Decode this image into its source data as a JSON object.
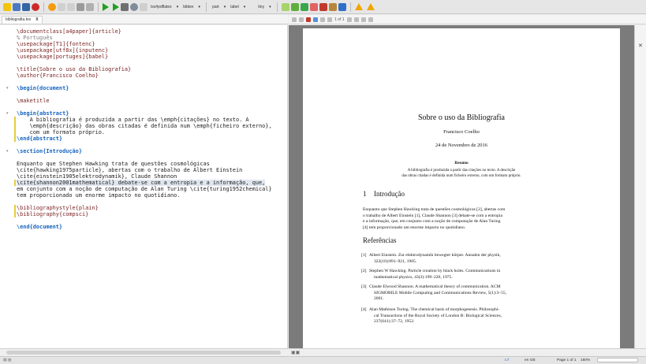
{
  "toolbar": {
    "typeset_format": "txs#pdflatex",
    "bibtool": "bibtex",
    "selects": [
      "part",
      "label",
      "tiny"
    ]
  },
  "editor": {
    "tab_label": "bibliografia.tex",
    "tab_close": "X",
    "lines": [
      {
        "t": "\\documentclass[a4paper]{article}",
        "c": "cmd"
      },
      {
        "t": "% Português",
        "c": "cm"
      },
      {
        "t": "\\usepackage[T1]{fontenc}",
        "c": "cmd"
      },
      {
        "t": "\\usepackage[utf8x]{inputenc}",
        "c": "cmd"
      },
      {
        "t": "\\usepackage[portuges]{babel}",
        "c": "cmd"
      },
      {
        "t": "",
        "c": ""
      },
      {
        "t": "\\title{Sobre o uso da Bibliografia}",
        "c": "cmd"
      },
      {
        "t": "\\author{Francisco Coelho}",
        "c": "cmd"
      },
      {
        "t": "",
        "c": ""
      },
      {
        "t": "\\begin{document}",
        "c": "env"
      },
      {
        "t": "",
        "c": ""
      },
      {
        "t": "\\maketitle",
        "c": "cmd"
      },
      {
        "t": "",
        "c": ""
      },
      {
        "t": "\\begin{abstract}",
        "c": "env"
      },
      {
        "t": "    A bibliografia é produzida a partir das \\emph{citações} no texto. A",
        "c": ""
      },
      {
        "t": "    \\emph{descrição} das obras citadas é definida num \\emph{ficheiro externo},",
        "c": ""
      },
      {
        "t": "    com um formato próprio.",
        "c": ""
      },
      {
        "t": "\\end{abstract}",
        "c": "env"
      },
      {
        "t": "",
        "c": ""
      },
      {
        "t": "\\section{Introdução}",
        "c": "env"
      },
      {
        "t": "",
        "c": ""
      },
      {
        "t": "Enquanto que Stephen Hawking trata de questões cosmológicas",
        "c": ""
      },
      {
        "t": "\\cite{hawking1975particle}, abertas com o trabalho de Albert Einstein",
        "c": ""
      },
      {
        "t": "\\cite{einstein1905elektrodynamik}, Claude Shannon",
        "c": ""
      },
      {
        "t": "\\cite{shannon2001mathematical} debate-se com a entropia e a informação, que,",
        "c": ""
      },
      {
        "t": "em conjunto com a noção de computação de Alan Turing \\cite{turing1952chemical}",
        "c": ""
      },
      {
        "t": "tem proporcionado um enorme impacto no quotidiano.",
        "c": ""
      },
      {
        "t": "",
        "c": ""
      },
      {
        "t": "\\bibliographystyle{plain}",
        "c": "cmd"
      },
      {
        "t": "\\bibliography{compsci}",
        "c": "cmd"
      },
      {
        "t": "",
        "c": ""
      },
      {
        "t": "\\end{document}",
        "c": "env"
      }
    ]
  },
  "pdf": {
    "page_nav": "1 of 1",
    "title": "Sobre o uso da Bibliografia",
    "author": "Francisco Coelho",
    "date": "24 de Novembro de 2016",
    "abstract_heading": "Resumo",
    "abstract_line1": "A bibliografia é produzida a partir das citações no texto. A descrição",
    "abstract_line2": "das obras citadas é definida num ficheiro externo, com um formato próprio.",
    "section_num": "1",
    "section_title": "Introdução",
    "body_lines": [
      "Enquanto que Stephen Hawking trata de questões cosmológicas [2], abertas com",
      "o trabalho de Albert Einstein [1], Claude Shannon [3] debate-se com a entropia",
      "e a informação, que, em conjunto com a noção de computação de Alan Turing",
      "[4] tem proporcionado um enorme impacto no quotidiano."
    ],
    "refs_heading": "Referências",
    "refs": [
      {
        "n": "[1]",
        "l": [
          "Albert Einstein. Zur elektrodynamik bewegter körper. Annalen der physik,",
          "322(10):891–921, 1905."
        ]
      },
      {
        "n": "[2]",
        "l": [
          "Stephen W Hawking. Particle creation by black holes. Communications in",
          "mathematical physics, 43(3):199–220, 1975."
        ]
      },
      {
        "n": "[3]",
        "l": [
          "Claude Elwood Shannon. A mathematical theory of communication. ACM",
          "SIGMOBILE Mobile Computing and Communications Review, 5(1):3–55,",
          "2001."
        ]
      },
      {
        "n": "[4]",
        "l": [
          "Alan Mathison Turing. The chemical basis of morphogenesis. Philosophi-",
          "cal Transactions of the Royal Society of London B: Biological Sciences,",
          "237(641):37–72, 1952."
        ]
      }
    ]
  },
  "status": {
    "page": "Page 1 of 1",
    "zoom": "160%",
    "lt": "LT",
    "lang": "en GB",
    "enc": "UTF-8",
    "ready": "Ready",
    "mode": "Automatic"
  }
}
